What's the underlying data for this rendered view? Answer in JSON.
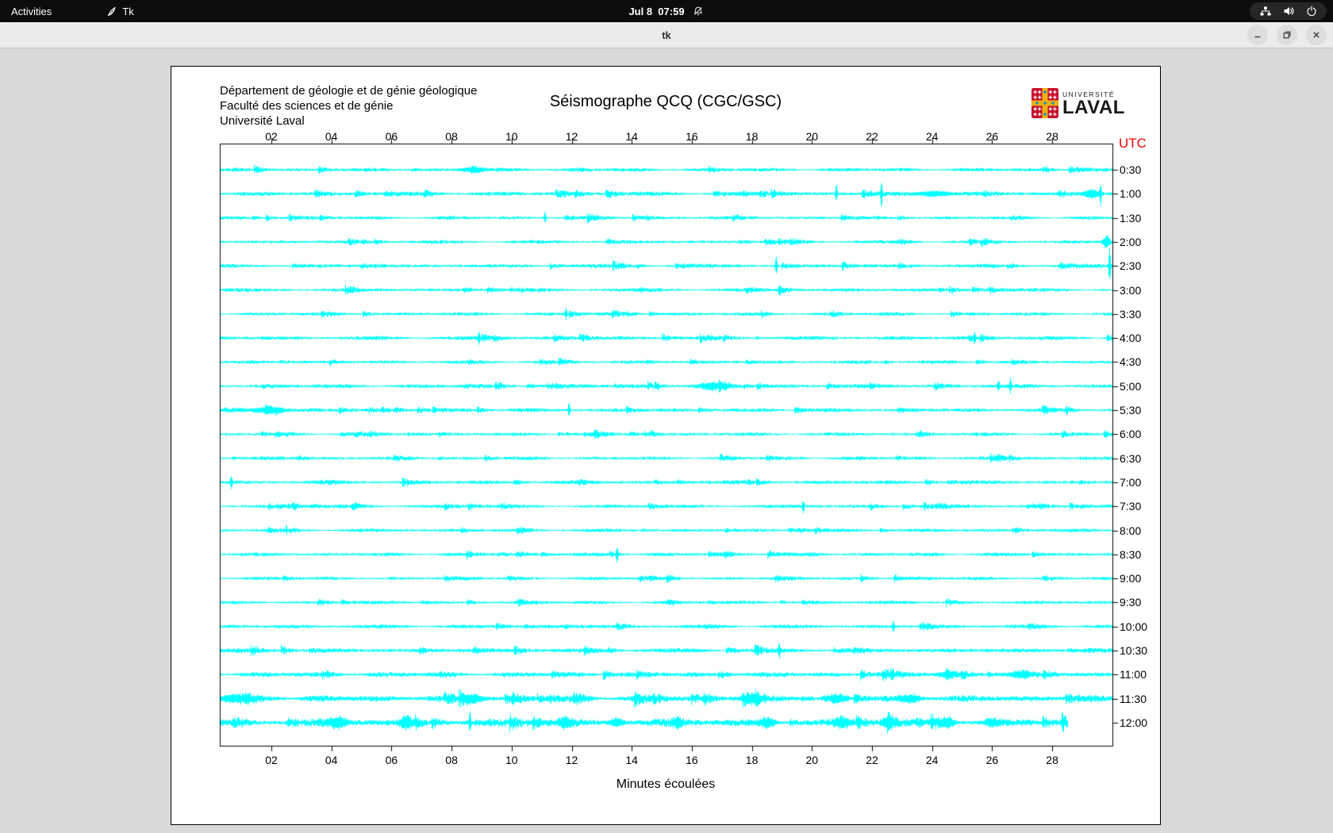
{
  "topbar": {
    "activities_label": "Activities",
    "app_name": "Tk",
    "clock": "Jul 8  07:59"
  },
  "titlebar": {
    "title": "tk"
  },
  "window": {
    "header_lines": [
      "Département de géologie et de génie géologique",
      "Faculté des sciences et de génie",
      "Université Laval"
    ],
    "title": "Séismographe QCQ (CGC/GSC)",
    "logo": {
      "top": "UNIVERSITÉ",
      "bottom": "LAVAL"
    },
    "utc_label": "UTC",
    "xlabel": "Minutes écoulées"
  },
  "icons": [
    "tk-feather-icon",
    "bell-muted-icon",
    "network-icon",
    "volume-icon",
    "power-icon",
    "minimize-icon",
    "restore-icon",
    "close-icon"
  ],
  "chart_data": {
    "type": "line",
    "title": "Séismographe QCQ (CGC/GSC)",
    "xlabel": "Minutes écoulées",
    "right_axis_label": "UTC",
    "x_range_minutes": [
      0,
      30
    ],
    "x_tick_minutes": [
      2,
      4,
      6,
      8,
      10,
      12,
      14,
      16,
      18,
      20,
      22,
      24,
      26,
      28
    ],
    "x_tick_labels": [
      "02",
      "04",
      "06",
      "08",
      "10",
      "12",
      "14",
      "16",
      "18",
      "20",
      "22",
      "24",
      "26",
      "28"
    ],
    "trace_color": "#00ffff",
    "axis_color": "#000000",
    "utc_color": "#f00100",
    "rows": [
      {
        "label": "0:30",
        "amp": 1.7,
        "events": [
          {
            "type": "burst",
            "m": 8.7,
            "a": 3,
            "w": 6
          }
        ]
      },
      {
        "label": "1:00",
        "amp": 2.0,
        "events": [
          {
            "type": "spike",
            "m": 20.8,
            "a": 11
          },
          {
            "type": "spike",
            "m": 22.3,
            "a": 14
          },
          {
            "type": "burst",
            "m": 24.1,
            "a": 3.5,
            "w": 8
          },
          {
            "type": "burst",
            "m": 29.3,
            "a": 5,
            "w": 4
          },
          {
            "type": "spike",
            "m": 29.6,
            "a": 15
          }
        ]
      },
      {
        "label": "1:30",
        "amp": 1.6,
        "events": [
          {
            "type": "spike",
            "m": 11.1,
            "a": 8
          }
        ]
      },
      {
        "label": "2:00",
        "amp": 1.6,
        "events": [
          {
            "type": "burst",
            "m": 29.8,
            "a": 7,
            "w": 2
          }
        ]
      },
      {
        "label": "2:30",
        "amp": 1.8,
        "events": [
          {
            "type": "spike",
            "m": 18.8,
            "a": 11
          },
          {
            "type": "spike",
            "m": 29.9,
            "a": 22
          }
        ]
      },
      {
        "label": "3:00",
        "amp": 1.7,
        "events": [
          {
            "type": "spike",
            "m": 18.9,
            "a": 7
          }
        ]
      },
      {
        "label": "3:30",
        "amp": 1.6,
        "events": [
          {
            "type": "spike",
            "m": 11.8,
            "a": 8
          }
        ]
      },
      {
        "label": "4:00",
        "amp": 1.8,
        "events": [
          {
            "type": "spike",
            "m": 8.9,
            "a": 9
          },
          {
            "type": "spike",
            "m": 25.4,
            "a": 7
          }
        ]
      },
      {
        "label": "4:30",
        "amp": 1.6,
        "events": []
      },
      {
        "label": "5:00",
        "amp": 1.9,
        "events": [
          {
            "type": "burst",
            "m": 16.7,
            "a": 3.5,
            "w": 8
          },
          {
            "type": "spike",
            "m": 26.2,
            "a": 7
          },
          {
            "type": "spike",
            "m": 26.6,
            "a": 9
          }
        ]
      },
      {
        "label": "5:30",
        "amp": 1.8,
        "events": [
          {
            "type": "burst",
            "m": 1.9,
            "a": 3.5,
            "w": 8
          },
          {
            "type": "spike",
            "m": 11.9,
            "a": 9
          }
        ]
      },
      {
        "label": "6:00",
        "amp": 1.6,
        "events": []
      },
      {
        "label": "6:30",
        "amp": 1.6,
        "events": []
      },
      {
        "label": "7:00",
        "amp": 1.8,
        "events": [
          {
            "type": "spike",
            "m": 0.65,
            "a": 10
          }
        ]
      },
      {
        "label": "7:30",
        "amp": 1.7,
        "events": [
          {
            "type": "spike",
            "m": 19.7,
            "a": 8
          }
        ]
      },
      {
        "label": "8:00",
        "amp": 1.6,
        "events": []
      },
      {
        "label": "8:30",
        "amp": 1.7,
        "events": [
          {
            "type": "spike",
            "m": 13.5,
            "a": 8
          }
        ]
      },
      {
        "label": "9:00",
        "amp": 1.6,
        "events": []
      },
      {
        "label": "9:30",
        "amp": 1.6,
        "events": []
      },
      {
        "label": "10:00",
        "amp": 1.8,
        "events": [
          {
            "type": "spike",
            "m": 22.7,
            "a": 7
          }
        ]
      },
      {
        "label": "10:30",
        "amp": 2.1,
        "events": [
          {
            "type": "spike",
            "m": 18.9,
            "a": 8
          }
        ]
      },
      {
        "label": "11:00",
        "amp": 2.4,
        "events": [
          {
            "type": "burst",
            "m": 24.5,
            "a": 3,
            "w": 6
          },
          {
            "type": "burst",
            "m": 27.0,
            "a": 3,
            "w": 6
          }
        ]
      },
      {
        "label": "11:30",
        "amp": 3.1,
        "events": [
          {
            "type": "burst",
            "m": 0.8,
            "a": 4,
            "w": 9
          },
          {
            "type": "burst",
            "m": 8.7,
            "a": 4,
            "w": 6
          },
          {
            "type": "burst",
            "m": 18.0,
            "a": 4,
            "w": 5
          },
          {
            "type": "burst",
            "m": 20.8,
            "a": 4,
            "w": 5
          },
          {
            "type": "burst",
            "m": 23.3,
            "a": 4,
            "w": 6
          }
        ]
      },
      {
        "label": "12:00",
        "amp": 3.5,
        "end_minute": 28.5,
        "events": [
          {
            "type": "burst",
            "m": 4.2,
            "a": 5,
            "w": 5
          },
          {
            "type": "burst",
            "m": 6.5,
            "a": 7,
            "w": 3
          },
          {
            "type": "spike",
            "m": 8.6,
            "a": 12
          },
          {
            "type": "burst",
            "m": 11.8,
            "a": 5,
            "w": 4
          },
          {
            "type": "burst",
            "m": 13.5,
            "a": 5,
            "w": 4
          },
          {
            "type": "burst",
            "m": 15.5,
            "a": 5,
            "w": 3
          },
          {
            "type": "burst",
            "m": 18.5,
            "a": 5,
            "w": 4
          },
          {
            "type": "burst",
            "m": 21.0,
            "a": 5,
            "w": 4
          },
          {
            "type": "burst",
            "m": 22.5,
            "a": 5,
            "w": 3
          },
          {
            "type": "burst",
            "m": 24.5,
            "a": 5,
            "w": 4
          },
          {
            "type": "burst",
            "m": 26.0,
            "a": 4,
            "w": 4
          }
        ]
      }
    ]
  }
}
